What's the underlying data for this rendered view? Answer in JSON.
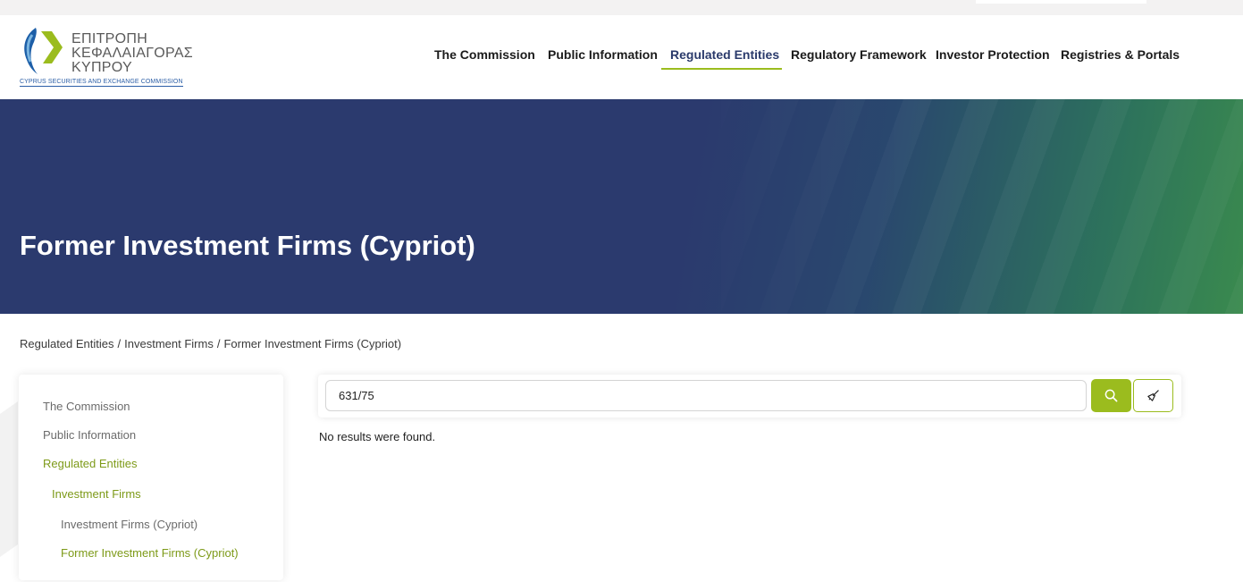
{
  "logo": {
    "line1": "ΕΠΙΤΡΟΠΗ",
    "line2": "ΚΕΦΑΛΑΙΑΓΟΡΑΣ",
    "line3": "ΚΥΠΡΟΥ",
    "subtitle": "CYPRUS SECURITIES AND EXCHANGE COMMISSION"
  },
  "nav": {
    "items": [
      {
        "label": "The Commission"
      },
      {
        "label": "Public Information"
      },
      {
        "label": "Regulated Entities",
        "active": true
      },
      {
        "label": "Regulatory Framework"
      },
      {
        "label": "Investor Protection"
      },
      {
        "label": "Registries & Portals"
      }
    ]
  },
  "hero": {
    "title": "Former Investment Firms (Cypriot)"
  },
  "breadcrumb": [
    "Regulated Entities",
    "Investment Firms",
    "Former Investment Firms (Cypriot)"
  ],
  "breadcrumb_separator": "/",
  "sidebar": {
    "items": [
      {
        "label": "The Commission"
      },
      {
        "label": "Public Information"
      },
      {
        "label": "Regulated Entities"
      },
      {
        "label": "Investment Firms"
      },
      {
        "label": "Investment Firms (Cypriot)"
      },
      {
        "label": "Former Investment Firms (Cypriot)"
      }
    ]
  },
  "search": {
    "value": "631/75",
    "no_results": "No results were found."
  },
  "colors": {
    "accent": "#9bbc1e",
    "hero_blue": "#2b3a6e",
    "hero_green": "#3a8a4e"
  },
  "icons": {
    "search": "search-icon",
    "clear": "broom-icon"
  }
}
